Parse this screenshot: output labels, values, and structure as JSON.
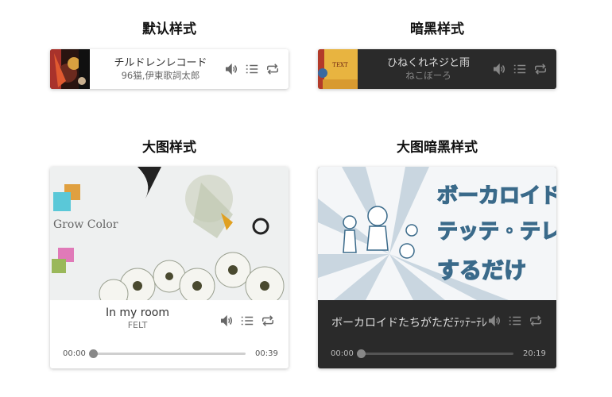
{
  "sections": {
    "default_title": "默认样式",
    "dark_title": "暗黑样式",
    "big_title": "大图样式",
    "big_dark_title": "大图暗黑样式"
  },
  "players": {
    "default": {
      "song": "チルドレンレコード",
      "artist": "96猫,伊東歌詞太郎"
    },
    "dark": {
      "song": "ひねくれネジと雨",
      "artist": "ねこぼーろ",
      "cover_text": "TEXT"
    },
    "big": {
      "song": "In my room",
      "artist": "FELT",
      "cover_title": "Grow Color",
      "current_time": "00:00",
      "duration": "00:39",
      "progress": 0.0
    },
    "big_dark": {
      "song": "ボーカロイドたちがただﾃｯﾃｰﾃﾚ",
      "cover_title": "ボーカロイドたちがただテッテ・テレッテーするだけ",
      "current_time": "00:00",
      "duration": "20:19",
      "progress": 0.0
    }
  },
  "icons": [
    "volume-icon",
    "playlist-icon",
    "loop-icon"
  ],
  "colors": {
    "light_bg": "#ffffff",
    "dark_bg": "#2a2a2a",
    "icon_light": "#666666",
    "icon_dark": "#888888"
  }
}
